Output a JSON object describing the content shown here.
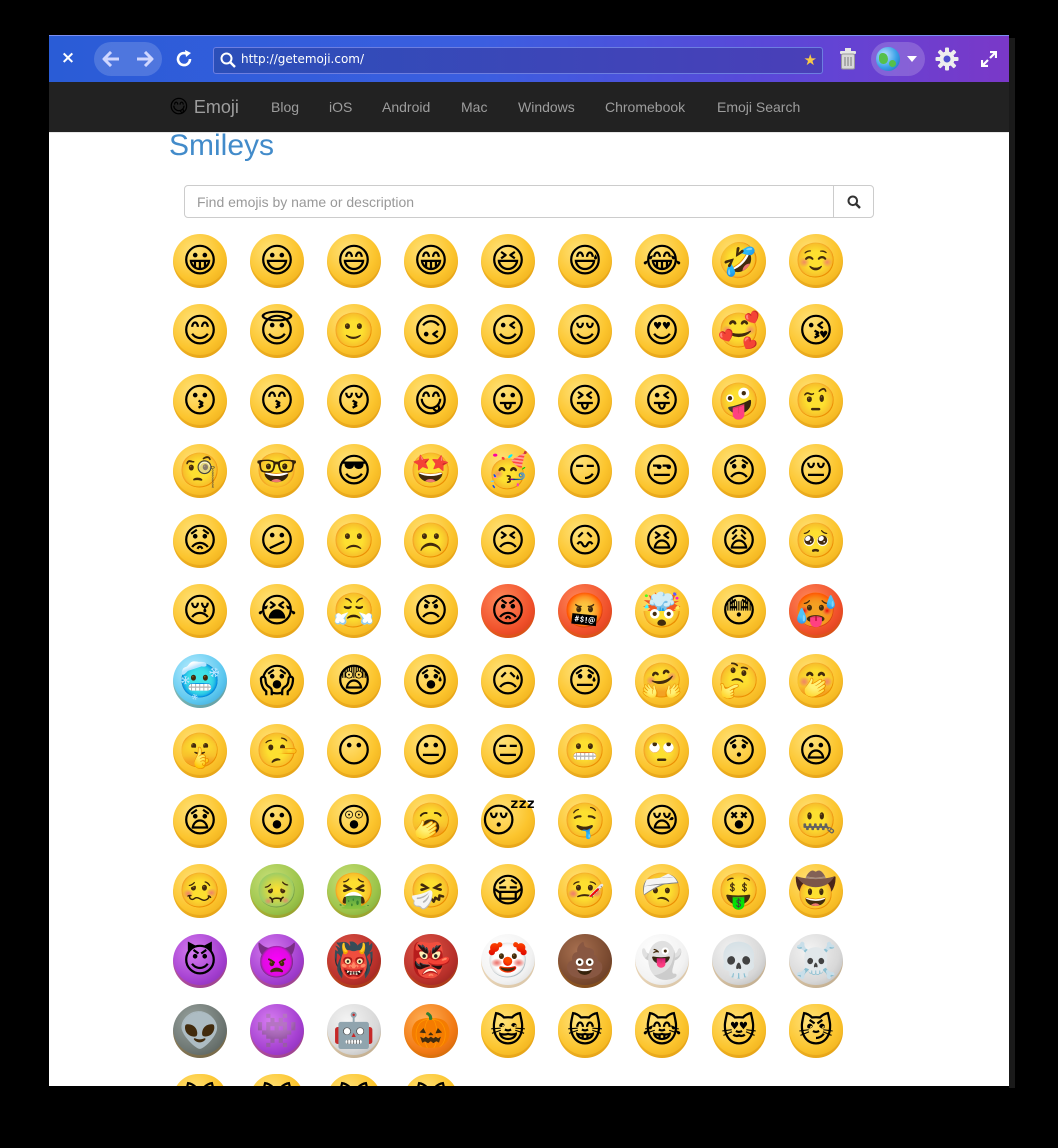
{
  "browser": {
    "close_label": "×",
    "url": "http://getemoji.com/"
  },
  "site": {
    "brand_emoji": "😋",
    "brand": "Emoji",
    "nav": [
      "Blog",
      "iOS",
      "Android",
      "Mac",
      "Windows",
      "Chromebook",
      "Emoji Search"
    ]
  },
  "page": {
    "title": "Smileys",
    "search_placeholder": "Find emojis by name or description"
  },
  "emoji_grid": {
    "columns": 9,
    "emojis": [
      "😀",
      "😃",
      "😄",
      "😁",
      "😆",
      "😅",
      "😂",
      "🤣",
      "☺️",
      "😊",
      "😇",
      "🙂",
      "🙃",
      "😉",
      "😌",
      "😍",
      "🥰",
      "😘",
      "😗",
      "😙",
      "😚",
      "😋",
      "😛",
      "😝",
      "😜",
      "🤪",
      "🤨",
      "🧐",
      "🤓",
      "😎",
      "🤩",
      "🥳",
      "😏",
      "😒",
      "😞",
      "😔",
      "😟",
      "😕",
      "🙁",
      "☹️",
      "😣",
      "😖",
      "😫",
      "😩",
      "🥺",
      "😢",
      "😭",
      "😤",
      "😠",
      "😡",
      "🤬",
      "🤯",
      "😳",
      "🥵",
      "🥶",
      "😱",
      "😨",
      "😰",
      "😥",
      "😓",
      "🤗",
      "🤔",
      "🤭",
      "🤫",
      "🤥",
      "😶",
      "😐",
      "😑",
      "😬",
      "🙄",
      "😯",
      "😦",
      "😧",
      "😮",
      "😲",
      "🥱",
      "😴",
      "🤤",
      "😪",
      "😵",
      "🤐",
      "🥴",
      "🤢",
      "🤮",
      "🤧",
      "😷",
      "🤒",
      "🤕",
      "🤑",
      "🤠",
      "😈",
      "👿",
      "👹",
      "👺",
      "🤡",
      "💩",
      "👻",
      "💀",
      "☠️",
      "👽",
      "👾",
      "🤖",
      "🎃",
      "😺",
      "😸",
      "😹",
      "😻",
      "😼",
      "😽",
      "🙀",
      "😿",
      "😾"
    ]
  },
  "colors": {
    "toolbar_start": "#2a5cd6",
    "toolbar_end": "#7a38c8",
    "navbar_bg": "#222222",
    "nav_text": "#9d9d9d",
    "title": "#428bca"
  }
}
